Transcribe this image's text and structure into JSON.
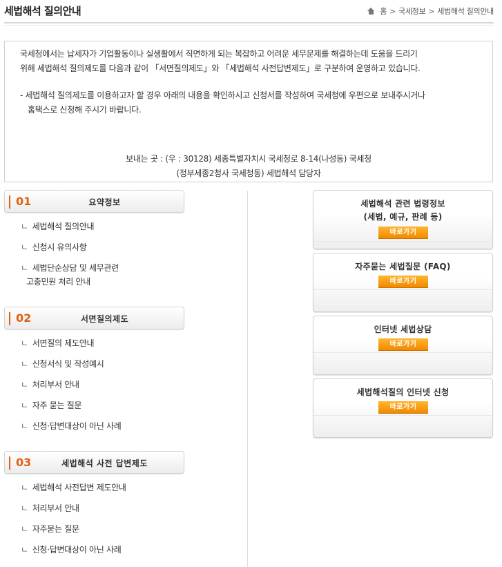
{
  "header": {
    "title": "세법해석 질의안내",
    "breadcrumb": [
      "홈",
      "국세정보",
      "세법해석 질의안내"
    ]
  },
  "info": {
    "para1_line1": "국세청에서는 납세자가 기업활동이나 실생활에서 직면하게 되는 복잡하고 어려운 세무문제를 해결하는데 도움을 드리기",
    "para1_line2": "위해 세법해석 질의제도를 다음과 같이 「서면질의제도」와 「세법해석 사전답변제도」로 구분하여 운영하고 있습니다.",
    "para2_line1": "- 세법해석 질의제도를 이용하고자 할 경우 아래의 내용을 확인하시고 신청서를 작성하여 국세청에 우편으로 보내주시거나",
    "para2_line2": "홈택스로 신청해 주시기 바랍니다.",
    "address_line1": "보내는 곳 : (우 : 30128) 세종특별자치시 국세청로 8-14(나성동) 국세청",
    "address_line2": "(정부세종2청사 국세청동) 세법해석 담당자"
  },
  "sections": [
    {
      "num": "01",
      "title": "요약정보",
      "items": [
        "세법해석 질의안내",
        "신청시 유의사항",
        "세법단순상담 및 세무관련"
      ],
      "item_continuation": "고충민원 처리 안내"
    },
    {
      "num": "02",
      "title": "서면질의제도",
      "items": [
        "서면질의 제도안내",
        "신청서식 및 작성예시",
        "처리부서 안내",
        "자주 묻는 질문",
        "신청·답변대상이 아닌 사례"
      ]
    },
    {
      "num": "03",
      "title": "세법해석 사전 답변제도",
      "items": [
        "세법해석 사전답변 제도안내",
        "처리부서 안내",
        "자주묻는 질문",
        "신청·답변대상이 아닌 사례"
      ]
    }
  ],
  "sub_marker": "ㄴ",
  "cards": [
    {
      "title_line1": "세법해석 관련 법령정보",
      "title_line2": "(세법, 예규, 판례 등)",
      "button": "바로가기"
    },
    {
      "title_line1": "자주묻는 세법질문 (FAQ)",
      "button": "바로가기"
    },
    {
      "title_line1": "인터넷 세법상담",
      "button": "바로가기"
    },
    {
      "title_line1": "세법해석질의 인터넷 신청",
      "button": "바로가기"
    }
  ],
  "colors": {
    "accent": "#e06010",
    "button": "#f5a000"
  }
}
